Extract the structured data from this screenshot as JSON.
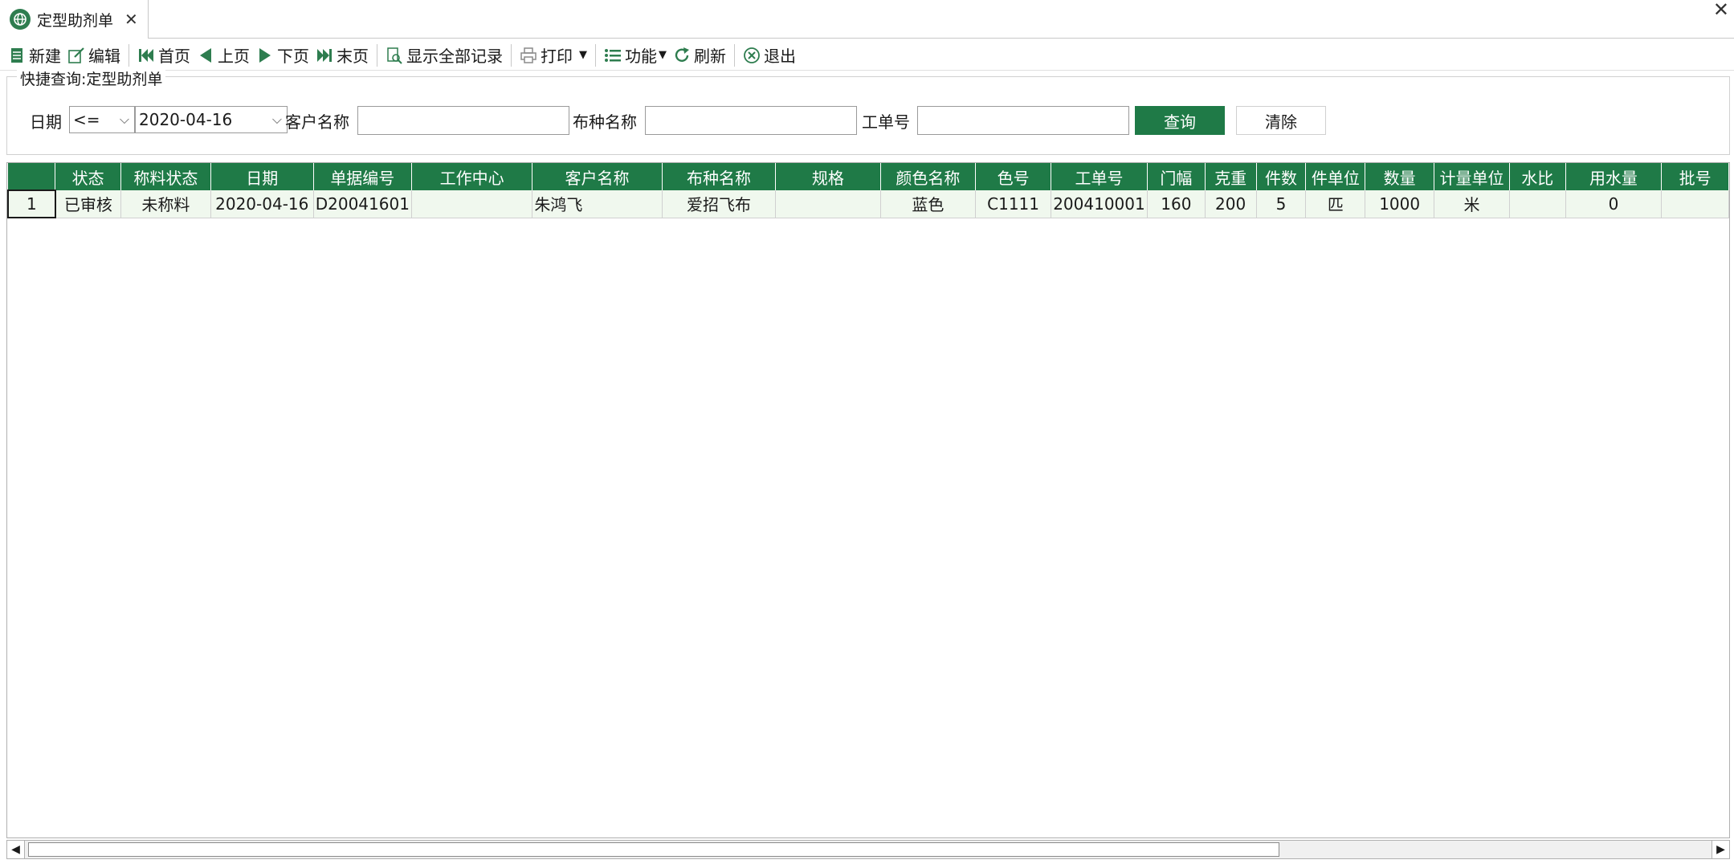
{
  "tab": {
    "title": "定型助剂单",
    "close": "✕"
  },
  "window_close": "✕",
  "toolbar": {
    "new": "新建",
    "edit": "编辑",
    "first": "首页",
    "prev": "上页",
    "next": "下页",
    "last": "末页",
    "show_all": "显示全部记录",
    "print": "打印",
    "functions": "功能",
    "refresh": "刷新",
    "exit": "退出"
  },
  "query": {
    "legend": "快捷查询:定型助剂单",
    "date_label": "日期",
    "operator": "<=",
    "date_value": "2020-04-16",
    "customer_label": "客户名称",
    "customer_value": "",
    "fabric_label": "布种名称",
    "fabric_value": "",
    "order_label": "工单号",
    "order_value": "",
    "search_button": "查询",
    "clear_button": "清除"
  },
  "grid": {
    "columns": [
      "",
      "状态",
      "称料状态",
      "日期",
      "单据编号",
      "工作中心",
      "客户名称",
      "布种名称",
      "规格",
      "颜色名称",
      "色号",
      "工单号",
      "门幅",
      "克重",
      "件数",
      "件单位",
      "数量",
      "计量单位",
      "水比",
      "用水量",
      "批号"
    ],
    "rows": [
      [
        "1",
        "已审核",
        "未称料",
        "2020-04-16",
        "D20041601",
        "",
        "朱鸿飞",
        "爱招飞布",
        "",
        "蓝色",
        "C1111",
        "200410001",
        "160",
        "200",
        "5",
        "匹",
        "1000",
        "米",
        "",
        "0",
        ""
      ]
    ]
  },
  "colors": {
    "accent": "#1f7a47",
    "row_bg": "#f0f8ee"
  }
}
